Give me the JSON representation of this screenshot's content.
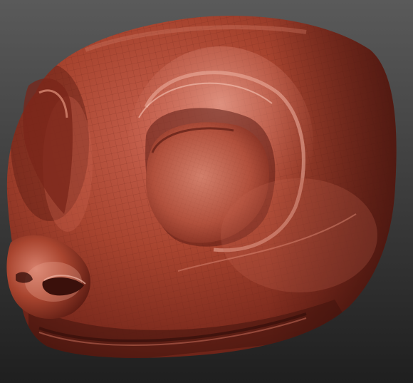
{
  "scene": {
    "subject": "sculpted-creature-head",
    "colors": {
      "background_top": "#5a5a5a",
      "background_bottom": "#1f1f1f",
      "clay_base": "#9a3a2c",
      "clay_light": "#c8624f",
      "clay_highlight": "#e9a08d",
      "clay_shadow": "#5c1c14",
      "clay_deep_shadow": "#3a100b",
      "wireframe": "#6a2217"
    }
  }
}
